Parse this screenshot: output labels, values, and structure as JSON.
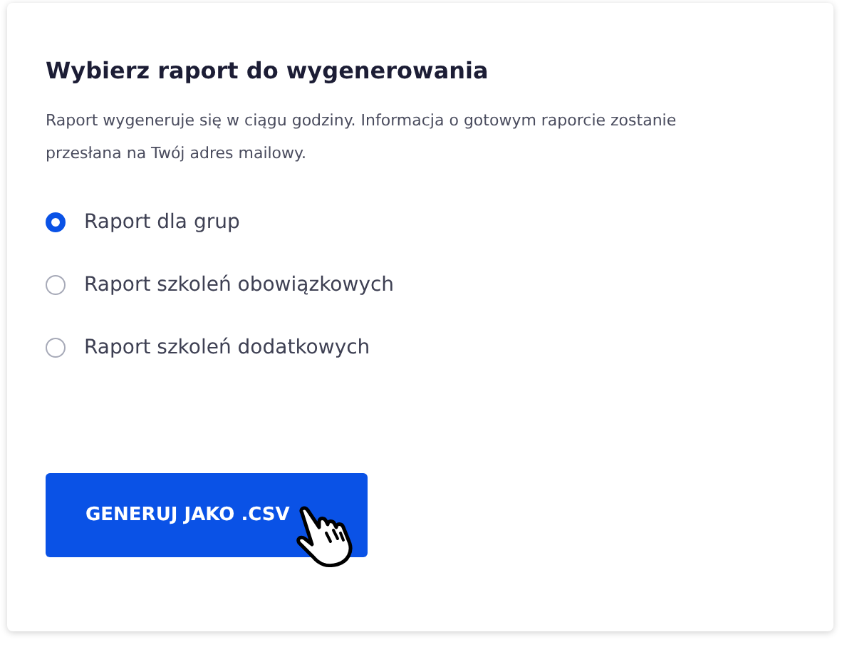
{
  "title": "Wybierz raport do wygenerowania",
  "description": "Raport wygeneruje się w ciągu godziny. Informacja o gotowym raporcie zostanie przesłana na Twój adres mailowy.",
  "options": [
    {
      "label": "Raport dla grup",
      "selected": true
    },
    {
      "label": "Raport szkoleń obowiązkowych",
      "selected": false
    },
    {
      "label": "Raport szkoleń dodatkowych",
      "selected": false
    }
  ],
  "button": {
    "label": "GENERUJ JAKO .CSV"
  }
}
